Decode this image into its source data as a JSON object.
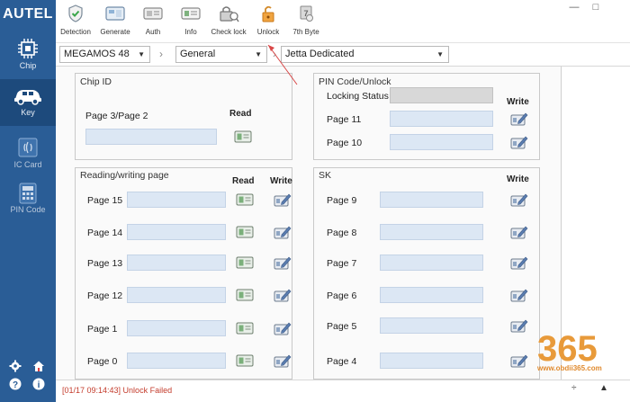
{
  "app": {
    "brand": "AUTEL"
  },
  "colors": {
    "sidebar": "#2a5d96",
    "sidebar_active": "#1d4a7c",
    "field": "#dce7f4",
    "status_error": "#c43c2c",
    "watermark": "#e08a2e"
  },
  "sidebar": {
    "items": [
      {
        "label": "Chip",
        "icon": "chip-icon"
      },
      {
        "label": "Key",
        "icon": "car-key-icon",
        "active": true
      },
      {
        "label": "IC Card",
        "icon": "ic-card-icon"
      },
      {
        "label": "PIN Code",
        "icon": "pin-code-icon"
      }
    ],
    "bottom_icons": [
      "settings-icon",
      "home-icon",
      "help-icon",
      "info-icon"
    ]
  },
  "toolbar": {
    "items": [
      {
        "label": "Detection",
        "icon": "detection-icon"
      },
      {
        "label": "Generate",
        "icon": "generate-icon"
      },
      {
        "label": "Auth",
        "icon": "auth-icon"
      },
      {
        "label": "Info",
        "icon": "info-card-icon"
      },
      {
        "label": "Check lock",
        "icon": "check-lock-icon"
      },
      {
        "label": "Unlock",
        "icon": "unlock-icon"
      },
      {
        "label": "7th Byte",
        "icon": "seventh-byte-icon"
      }
    ],
    "window_controls": [
      "—",
      "□"
    ]
  },
  "selectors": {
    "chip": "MEGAMOS 48",
    "mode": "General",
    "vehicle": "Jetta Dedicated",
    "separator": "›"
  },
  "chip_id": {
    "title": "Chip ID",
    "page_label": "Page 3/Page 2",
    "read_label": "Read",
    "value": ""
  },
  "pin_code": {
    "title": "PIN Code/Unlock",
    "locking_status_label": "Locking Status",
    "write_label": "Write",
    "rows": [
      {
        "label": "Page 11",
        "value": ""
      },
      {
        "label": "Page 10",
        "value": ""
      }
    ]
  },
  "rw_page": {
    "title": "Reading/writing page",
    "read_label": "Read",
    "write_label": "Write",
    "rows": [
      {
        "label": "Page 15",
        "value": ""
      },
      {
        "label": "Page 14",
        "value": ""
      },
      {
        "label": "Page 13",
        "value": ""
      },
      {
        "label": "Page 12",
        "value": ""
      },
      {
        "label": "Page 1",
        "value": ""
      },
      {
        "label": "Page 0",
        "value": ""
      }
    ]
  },
  "sk": {
    "title": "SK",
    "write_label": "Write",
    "rows": [
      {
        "label": "Page 9",
        "value": ""
      },
      {
        "label": "Page 8",
        "value": ""
      },
      {
        "label": "Page 7",
        "value": ""
      },
      {
        "label": "Page 6",
        "value": ""
      },
      {
        "label": "Page 5",
        "value": ""
      },
      {
        "label": "Page 4",
        "value": ""
      }
    ]
  },
  "status": {
    "message": "[01/17 09:14:43] Unlock Failed"
  },
  "statusbar_controls": [
    "÷",
    "▲"
  ],
  "watermark": {
    "logo": "365",
    "url": "www.obdii365.com"
  }
}
